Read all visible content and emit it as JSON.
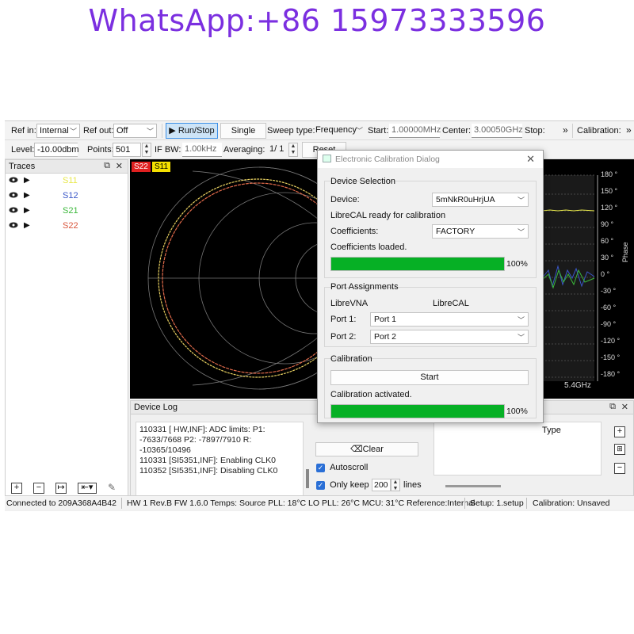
{
  "banner": "WhatsApp:+86 15973333596",
  "toolbar1": {
    "ref_in_label": "Ref in:",
    "ref_in_value": "Internal",
    "ref_out_label": "Ref out:",
    "ref_out_value": "Off",
    "run_stop": "▶ Run/Stop",
    "single": "Single",
    "sweep_type_label": "Sweep type:",
    "sweep_type_value": "Frequency",
    "start_label": "Start:",
    "start_value": "1.00000MHz",
    "center_label": "Center:",
    "center_value": "3.00050GHz",
    "stop_label": "Stop:",
    "overflow": "»",
    "calibration_label": "Calibration:"
  },
  "toolbar2": {
    "level_label": "Level:",
    "level_value": "-10.00dbm",
    "points_label": "Points:",
    "points_value": "501",
    "ifbw_label": "IF BW:",
    "ifbw_value": "1.00kHz",
    "averaging_label": "Averaging:",
    "averaging_value": "1/ 1",
    "reset": "Reset"
  },
  "traces": {
    "title": "Traces",
    "items": [
      {
        "name": "S11",
        "color": "#e8e84a"
      },
      {
        "name": "S12",
        "color": "#3a57c8"
      },
      {
        "name": "S21",
        "color": "#3bb83b"
      },
      {
        "name": "S22",
        "color": "#d9553b"
      }
    ]
  },
  "graph": {
    "tags": [
      "S22",
      "S11"
    ],
    "phase_axis_label": "Phase",
    "phase_ticks": [
      "180 °",
      "150 °",
      "120 °",
      "90 °",
      "60 °",
      "30 °",
      "0 °",
      "-30 °",
      "-60 °",
      "-90 °",
      "-120 °",
      "-150 °",
      "-180 °"
    ],
    "freq_label": "5.4GHz"
  },
  "device_log": {
    "title": "Device Log",
    "lines": [
      "110331 [    HW,INF]: ADC limits: P1:",
      "-7633/7668 P2: -7897/7910 R:",
      "-10365/10496",
      "110331 [SI5351,INF]: Enabling CLK0",
      "110352 [SI5351,INF]: Disabling CLK0"
    ],
    "clear": "Clear",
    "autoscroll": "Autoscroll",
    "only_keep": "Only keep",
    "keep_value": "200",
    "lines_label": "lines",
    "type_header": "Type"
  },
  "status": {
    "connected": "Connected to 209A368A4B42",
    "hw": "HW 1 Rev.B FW 1.6.0 Temps: Source PLL: 18°C LO PLL: 26°C MCU: 31°C Reference:Internal",
    "setup": "Setup: 1.setup",
    "calibration": "Calibration: Unsaved"
  },
  "dialog": {
    "title": "Electronic Calibration Dialog",
    "device_selection": "Device Selection",
    "device_label": "Device:",
    "device_value": "5mNkR0uHrjUA",
    "ready_text": "LibreCAL ready for calibration",
    "coefficients_label": "Coefficients:",
    "coefficients_value": "FACTORY",
    "coefficients_loaded": "Coefficients loaded.",
    "progress1": 100,
    "progress1_text": "100%",
    "port_assignments": "Port Assignments",
    "col_librevna": "LibreVNA",
    "col_librecal": "LibreCAL",
    "port1_label": "Port 1:",
    "port1_value": "Port 1",
    "port2_label": "Port 2:",
    "port2_value": "Port 2",
    "calibration": "Calibration",
    "start": "Start",
    "activated": "Calibration activated.",
    "progress2": 100,
    "progress2_text": "100%"
  }
}
